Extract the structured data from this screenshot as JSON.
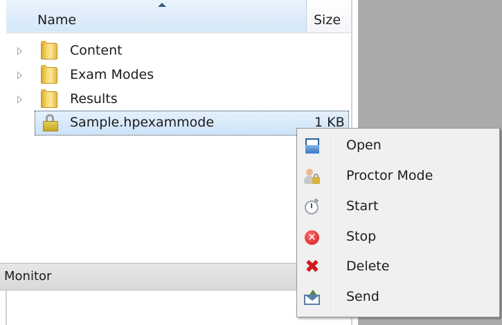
{
  "file_list": {
    "columns": {
      "name": "Name",
      "size": "Size"
    },
    "sorted_by": "name",
    "items": [
      {
        "label": "Content",
        "icon": "folder-icon",
        "expandable": true
      },
      {
        "label": "Exam Modes",
        "icon": "folder-icon",
        "expandable": true
      },
      {
        "label": "Results",
        "icon": "folder-icon",
        "expandable": true
      },
      {
        "label": "Sample.hpexammode",
        "icon": "lock-icon",
        "size": "1 KB",
        "selected": true
      }
    ]
  },
  "monitor": {
    "label": "Monitor"
  },
  "context_menu": {
    "items": [
      {
        "label": "Open",
        "icon": "open-document-icon"
      },
      {
        "label": "Proctor Mode",
        "icon": "proctor-user-lock-icon"
      },
      {
        "label": "Start",
        "icon": "stopwatch-icon"
      },
      {
        "label": "Stop",
        "icon": "stop-icon"
      },
      {
        "label": "Delete",
        "icon": "delete-x-icon"
      },
      {
        "label": "Send",
        "icon": "send-envelope-icon"
      }
    ]
  },
  "colors": {
    "header_gradient_top": "#e9f3fc",
    "selection": "#cde3f8",
    "menu_background": "#f0f0f0",
    "stop_red": "#d01818",
    "delete_red": "#d11a1a",
    "right_panel_gray": "#aaaaaa"
  }
}
